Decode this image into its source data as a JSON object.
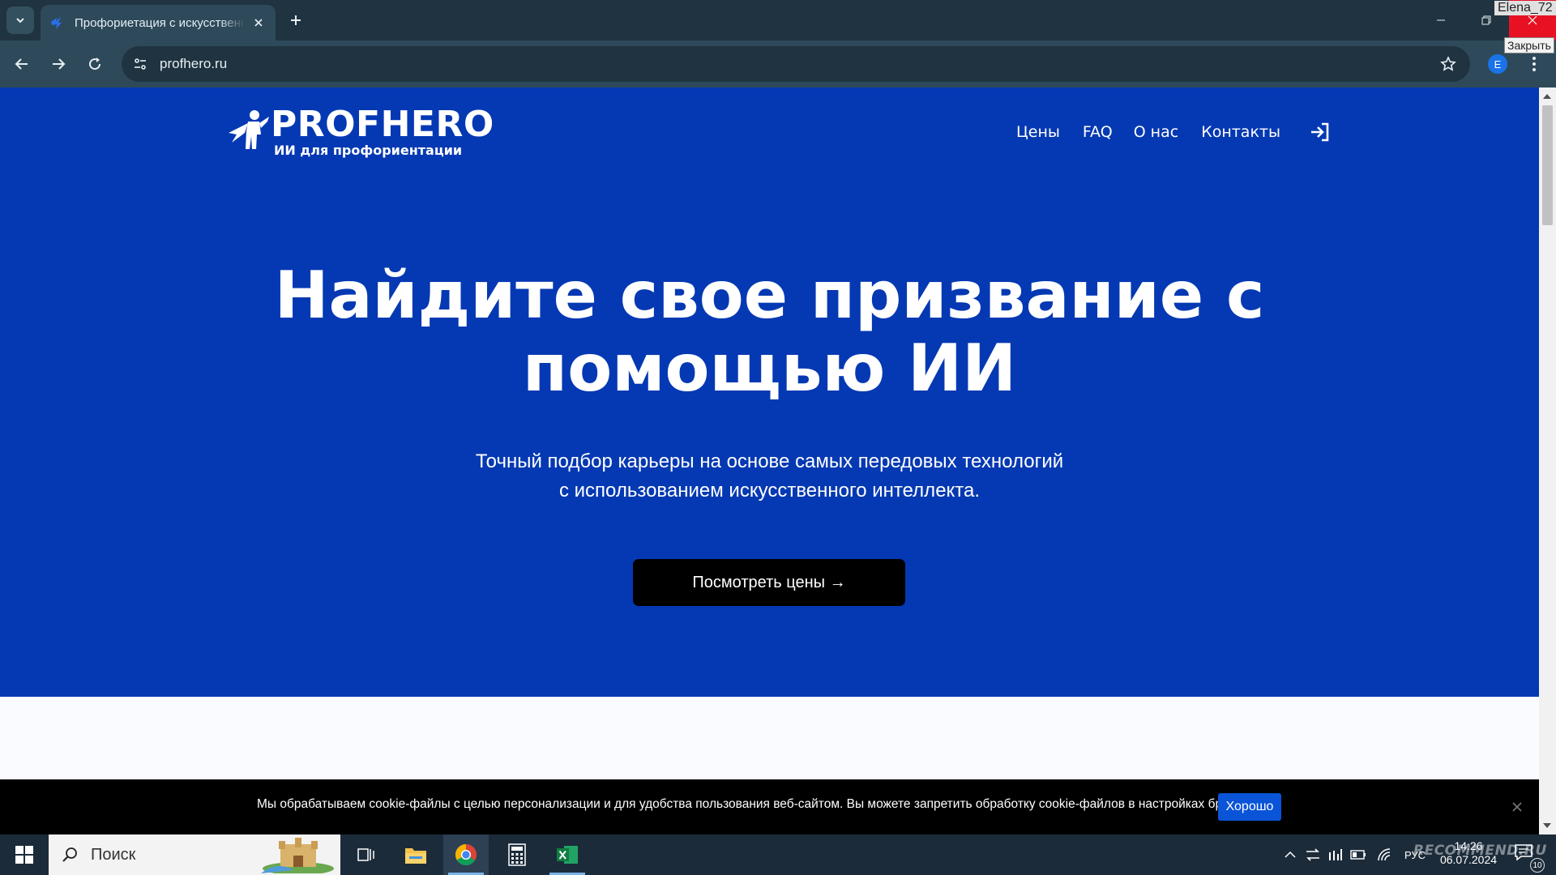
{
  "browser": {
    "tab": {
      "title": "Профориетация с искусственным интеллектом"
    },
    "url": "profhero.ru",
    "profile_initial": "E",
    "user_watermark": "Elena_72",
    "close_tooltip": "Закрыть"
  },
  "site": {
    "logo": {
      "brand": "PROFHERO",
      "tagline": "ИИ для профориентации"
    },
    "nav": [
      {
        "label": "Цены"
      },
      {
        "label": "FAQ"
      },
      {
        "label": "О нас"
      },
      {
        "label": "Контакты"
      }
    ],
    "hero": {
      "headline_line1": "Найдите свое призвание с",
      "headline_line2": "помощью ИИ",
      "subtitle_line1": "Точный подбор карьеры на основе самых передовых технологий",
      "subtitle_line2": "с использованием искусственного интеллекта.",
      "cta_label": "Посмотреть цены →"
    },
    "colors": {
      "hero_bg": "#0539b3",
      "cta_bg": "#000000",
      "cookie_ok_bg": "#0a54d8"
    }
  },
  "cookie_banner": {
    "text": "Мы обрабатываем cookie-файлы с целью персонализации и для удобства пользования веб-сайтом. Вы можете запретить обработку cookie-файлов в настройках браузера.",
    "accept_label": "Хорошо"
  },
  "taskbar": {
    "search_placeholder": "Поиск",
    "lang": "РУС",
    "time": "14:26",
    "date": "06.07.2024",
    "notifications_count": "10",
    "watermark": "RECOMMEND.RU"
  }
}
